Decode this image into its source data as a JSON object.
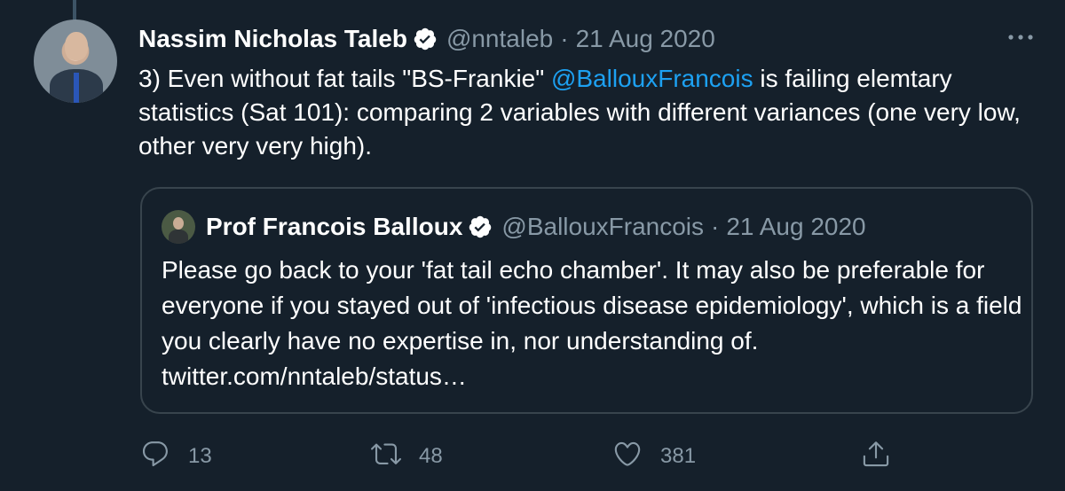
{
  "tweet": {
    "author_name": "Nassim Nicholas Taleb",
    "handle": "@nntaleb",
    "separator": "·",
    "date": "21 Aug 2020",
    "more_icon": "more-horizontal-icon",
    "text_before_mention": "3) Even without fat tails \"BS-Frankie\" ",
    "mention": "@BallouxFrancois",
    "text_after_mention": " is failing elemtary statistics (Sat 101): comparing 2 variables with different variances (one very low, other very very high)."
  },
  "quoted_tweet": {
    "author_name": "Prof Francois Balloux",
    "handle": "@BallouxFrancois",
    "separator": "·",
    "date": "21 Aug 2020",
    "text": "Please go back to your 'fat tail echo chamber'. It may also be preferable for everyone if you stayed out of 'infectious disease epidemiology', which is a field you clearly have no expertise in, nor understanding of. twitter.com/nntaleb/status…"
  },
  "actions": {
    "reply_count": "13",
    "retweet_count": "48",
    "like_count": "381"
  },
  "colors": {
    "background": "#15202b",
    "secondary_text": "#8899a6",
    "link": "#1da1f2",
    "border": "#38444d"
  }
}
